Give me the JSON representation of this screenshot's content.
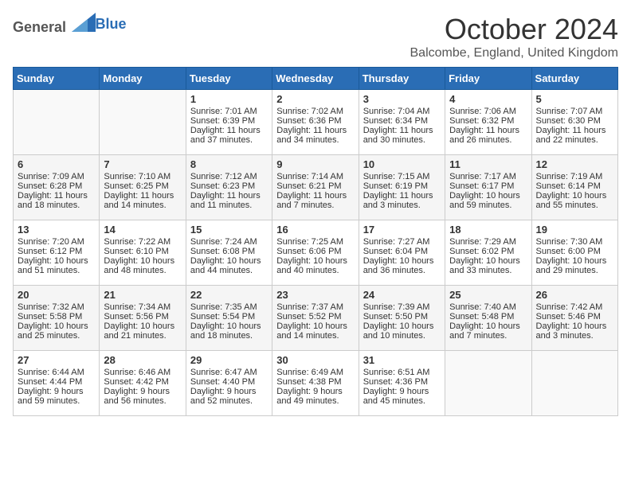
{
  "logo": {
    "general": "General",
    "blue": "Blue"
  },
  "header": {
    "month": "October 2024",
    "location": "Balcombe, England, United Kingdom"
  },
  "weekdays": [
    "Sunday",
    "Monday",
    "Tuesday",
    "Wednesday",
    "Thursday",
    "Friday",
    "Saturday"
  ],
  "weeks": [
    [
      {
        "day": "",
        "sunrise": "",
        "sunset": "",
        "daylight": ""
      },
      {
        "day": "",
        "sunrise": "",
        "sunset": "",
        "daylight": ""
      },
      {
        "day": "1",
        "sunrise": "Sunrise: 7:01 AM",
        "sunset": "Sunset: 6:39 PM",
        "daylight": "Daylight: 11 hours and 37 minutes."
      },
      {
        "day": "2",
        "sunrise": "Sunrise: 7:02 AM",
        "sunset": "Sunset: 6:36 PM",
        "daylight": "Daylight: 11 hours and 34 minutes."
      },
      {
        "day": "3",
        "sunrise": "Sunrise: 7:04 AM",
        "sunset": "Sunset: 6:34 PM",
        "daylight": "Daylight: 11 hours and 30 minutes."
      },
      {
        "day": "4",
        "sunrise": "Sunrise: 7:06 AM",
        "sunset": "Sunset: 6:32 PM",
        "daylight": "Daylight: 11 hours and 26 minutes."
      },
      {
        "day": "5",
        "sunrise": "Sunrise: 7:07 AM",
        "sunset": "Sunset: 6:30 PM",
        "daylight": "Daylight: 11 hours and 22 minutes."
      }
    ],
    [
      {
        "day": "6",
        "sunrise": "Sunrise: 7:09 AM",
        "sunset": "Sunset: 6:28 PM",
        "daylight": "Daylight: 11 hours and 18 minutes."
      },
      {
        "day": "7",
        "sunrise": "Sunrise: 7:10 AM",
        "sunset": "Sunset: 6:25 PM",
        "daylight": "Daylight: 11 hours and 14 minutes."
      },
      {
        "day": "8",
        "sunrise": "Sunrise: 7:12 AM",
        "sunset": "Sunset: 6:23 PM",
        "daylight": "Daylight: 11 hours and 11 minutes."
      },
      {
        "day": "9",
        "sunrise": "Sunrise: 7:14 AM",
        "sunset": "Sunset: 6:21 PM",
        "daylight": "Daylight: 11 hours and 7 minutes."
      },
      {
        "day": "10",
        "sunrise": "Sunrise: 7:15 AM",
        "sunset": "Sunset: 6:19 PM",
        "daylight": "Daylight: 11 hours and 3 minutes."
      },
      {
        "day": "11",
        "sunrise": "Sunrise: 7:17 AM",
        "sunset": "Sunset: 6:17 PM",
        "daylight": "Daylight: 10 hours and 59 minutes."
      },
      {
        "day": "12",
        "sunrise": "Sunrise: 7:19 AM",
        "sunset": "Sunset: 6:14 PM",
        "daylight": "Daylight: 10 hours and 55 minutes."
      }
    ],
    [
      {
        "day": "13",
        "sunrise": "Sunrise: 7:20 AM",
        "sunset": "Sunset: 6:12 PM",
        "daylight": "Daylight: 10 hours and 51 minutes."
      },
      {
        "day": "14",
        "sunrise": "Sunrise: 7:22 AM",
        "sunset": "Sunset: 6:10 PM",
        "daylight": "Daylight: 10 hours and 48 minutes."
      },
      {
        "day": "15",
        "sunrise": "Sunrise: 7:24 AM",
        "sunset": "Sunset: 6:08 PM",
        "daylight": "Daylight: 10 hours and 44 minutes."
      },
      {
        "day": "16",
        "sunrise": "Sunrise: 7:25 AM",
        "sunset": "Sunset: 6:06 PM",
        "daylight": "Daylight: 10 hours and 40 minutes."
      },
      {
        "day": "17",
        "sunrise": "Sunrise: 7:27 AM",
        "sunset": "Sunset: 6:04 PM",
        "daylight": "Daylight: 10 hours and 36 minutes."
      },
      {
        "day": "18",
        "sunrise": "Sunrise: 7:29 AM",
        "sunset": "Sunset: 6:02 PM",
        "daylight": "Daylight: 10 hours and 33 minutes."
      },
      {
        "day": "19",
        "sunrise": "Sunrise: 7:30 AM",
        "sunset": "Sunset: 6:00 PM",
        "daylight": "Daylight: 10 hours and 29 minutes."
      }
    ],
    [
      {
        "day": "20",
        "sunrise": "Sunrise: 7:32 AM",
        "sunset": "Sunset: 5:58 PM",
        "daylight": "Daylight: 10 hours and 25 minutes."
      },
      {
        "day": "21",
        "sunrise": "Sunrise: 7:34 AM",
        "sunset": "Sunset: 5:56 PM",
        "daylight": "Daylight: 10 hours and 21 minutes."
      },
      {
        "day": "22",
        "sunrise": "Sunrise: 7:35 AM",
        "sunset": "Sunset: 5:54 PM",
        "daylight": "Daylight: 10 hours and 18 minutes."
      },
      {
        "day": "23",
        "sunrise": "Sunrise: 7:37 AM",
        "sunset": "Sunset: 5:52 PM",
        "daylight": "Daylight: 10 hours and 14 minutes."
      },
      {
        "day": "24",
        "sunrise": "Sunrise: 7:39 AM",
        "sunset": "Sunset: 5:50 PM",
        "daylight": "Daylight: 10 hours and 10 minutes."
      },
      {
        "day": "25",
        "sunrise": "Sunrise: 7:40 AM",
        "sunset": "Sunset: 5:48 PM",
        "daylight": "Daylight: 10 hours and 7 minutes."
      },
      {
        "day": "26",
        "sunrise": "Sunrise: 7:42 AM",
        "sunset": "Sunset: 5:46 PM",
        "daylight": "Daylight: 10 hours and 3 minutes."
      }
    ],
    [
      {
        "day": "27",
        "sunrise": "Sunrise: 6:44 AM",
        "sunset": "Sunset: 4:44 PM",
        "daylight": "Daylight: 9 hours and 59 minutes."
      },
      {
        "day": "28",
        "sunrise": "Sunrise: 6:46 AM",
        "sunset": "Sunset: 4:42 PM",
        "daylight": "Daylight: 9 hours and 56 minutes."
      },
      {
        "day": "29",
        "sunrise": "Sunrise: 6:47 AM",
        "sunset": "Sunset: 4:40 PM",
        "daylight": "Daylight: 9 hours and 52 minutes."
      },
      {
        "day": "30",
        "sunrise": "Sunrise: 6:49 AM",
        "sunset": "Sunset: 4:38 PM",
        "daylight": "Daylight: 9 hours and 49 minutes."
      },
      {
        "day": "31",
        "sunrise": "Sunrise: 6:51 AM",
        "sunset": "Sunset: 4:36 PM",
        "daylight": "Daylight: 9 hours and 45 minutes."
      },
      {
        "day": "",
        "sunrise": "",
        "sunset": "",
        "daylight": ""
      },
      {
        "day": "",
        "sunrise": "",
        "sunset": "",
        "daylight": ""
      }
    ]
  ]
}
